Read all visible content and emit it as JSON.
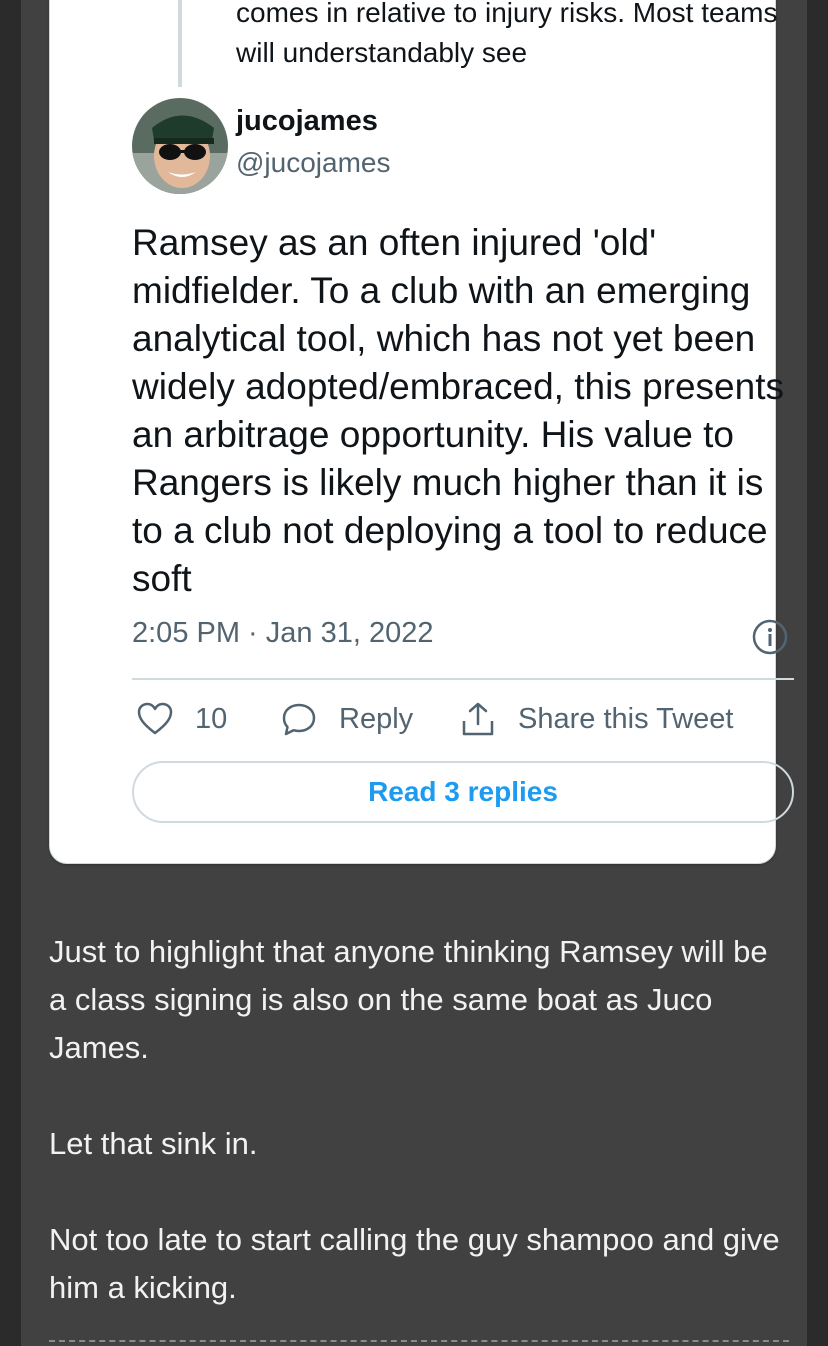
{
  "tweet": {
    "quoted_text": "comes in relative to injury risks. Most teams will understandably see",
    "display_name": "jucojames",
    "handle": "@jucojames",
    "body": "Ramsey as an often injured 'old' midfielder. To a club with an emerging analytical tool, which has not yet been widely adopted/embraced, this presents an arbitrage opportunity. His value to Rangers is likely much higher than it is to a club not deploying a tool to reduce soft",
    "timestamp": "2:05 PM · Jan 31, 2022",
    "like_count": "10",
    "reply_label": "Reply",
    "share_label": "Share this Tweet",
    "read_replies_label": "Read 3 replies"
  },
  "post": {
    "paragraphs": [
      "Just to highlight that anyone thinking Ramsey will be a class signing is also on the same boat as Juco James.",
      "Let that sink in.",
      "Not too late to start calling the guy shampoo and give him a kicking."
    ]
  },
  "colors": {
    "link_blue": "#1d9bf0",
    "secondary_text": "#536471",
    "post_background": "#414141"
  },
  "icons": [
    "avatar-photo",
    "info-icon",
    "heart-icon",
    "reply-bubble-icon",
    "share-icon"
  ]
}
